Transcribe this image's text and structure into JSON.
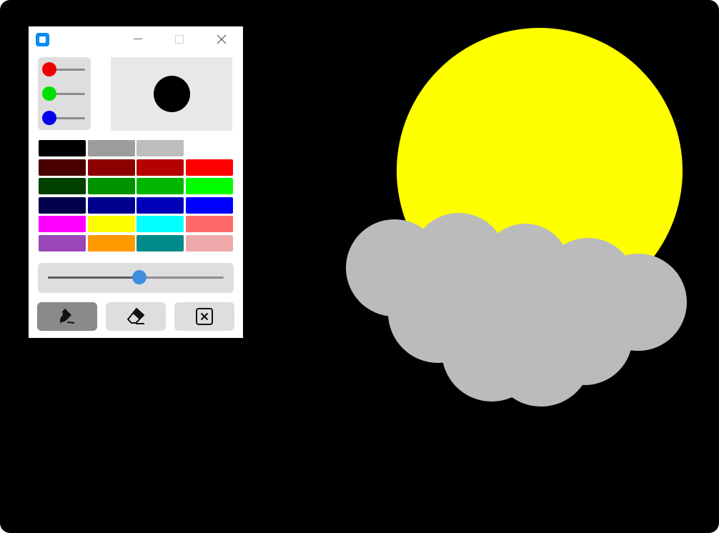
{
  "window": {
    "icons": {
      "app": "app-icon",
      "minimize": "minimize-icon",
      "maximize": "maximize-icon",
      "close": "close-icon"
    }
  },
  "rgb": {
    "red": {
      "color": "#ee0000",
      "level": 0
    },
    "green": {
      "color": "#00e000",
      "level": 0
    },
    "blue": {
      "color": "#0000ee",
      "level": 0
    }
  },
  "preview": {
    "color": "#000000"
  },
  "palette": [
    [
      "#000000",
      "#9c9c9c",
      "#bdbdbd",
      null
    ],
    [
      "#4a0000",
      "#8e0000",
      "#b70000",
      "#ff0000"
    ],
    [
      "#004100",
      "#009300",
      "#00b600",
      "#00ff00"
    ],
    [
      "#00004d",
      "#00008e",
      "#0000b8",
      "#0000ff"
    ],
    [
      "#ff00ff",
      "#ffff00",
      "#00ffff",
      "#ff6a6a"
    ],
    [
      "#9a46b8",
      "#ff9900",
      "#008b8b",
      "#eeaaaa"
    ]
  ],
  "brush_size": {
    "fraction": 0.52
  },
  "tools": [
    {
      "name": "brush",
      "icon": "brush-icon",
      "active": true
    },
    {
      "name": "eraser",
      "icon": "eraser-icon",
      "active": false
    },
    {
      "name": "clear",
      "icon": "clear-icon",
      "active": false
    }
  ],
  "canvas": {
    "background": "#000000",
    "sun_color": "#ffff00",
    "cloud_color": "#bbbbbb"
  }
}
